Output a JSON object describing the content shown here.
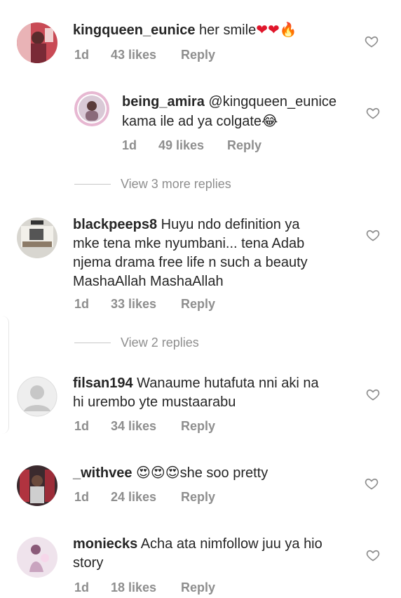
{
  "comments": [
    {
      "username": "kingqueen_eunice",
      "text": " her smile",
      "emojis": "❤❤",
      "emoji2": "🔥",
      "time": "1d",
      "likes": "43 likes",
      "reply": "Reply",
      "avatar_icon": "user-photo"
    },
    {
      "username": "being_amira",
      "mention": " @kingqueen_eunice",
      "text_line2": "kama ile ad ya colgate",
      "emoji": "😂",
      "time": "1d",
      "likes": "49 likes",
      "reply": "Reply",
      "avatar_icon": "user-photo"
    },
    {
      "view_more": "View 3 more replies"
    },
    {
      "username": "blackpeeps8",
      "text": " Huyu ndo definition ya",
      "line2": "mke tena mke nyumbani... tena Adab",
      "line3": "njema drama free life n such a beauty",
      "line4": "MashaAllah MashaAllah",
      "time": "1d",
      "likes": "33 likes",
      "reply": "Reply",
      "avatar_icon": "user-photo"
    },
    {
      "view_more": "View 2 replies"
    },
    {
      "username": "filsan194",
      "text": " Wanaume hutafuta nni aki na",
      "line2": "hi urembo yte mustaarabu",
      "time": "1d",
      "likes": "34 likes",
      "reply": "Reply",
      "avatar_icon": "default-avatar"
    },
    {
      "username": "_withvee",
      "emojis": "😍😍😍",
      "text": "she soo pretty",
      "time": "1d",
      "likes": "24 likes",
      "reply": "Reply",
      "avatar_icon": "user-photo"
    },
    {
      "username": "moniecks",
      "text": " Acha ata nimfollow juu ya hio",
      "line2": "story",
      "time": "1d",
      "likes": "18 likes",
      "reply": "Reply",
      "avatar_icon": "user-photo"
    }
  ],
  "colors": {
    "text": "#262626",
    "meta": "#8e8e8e",
    "heart_outline": "#8e8e8e"
  },
  "icons": {
    "like": "heart-outline-icon"
  }
}
